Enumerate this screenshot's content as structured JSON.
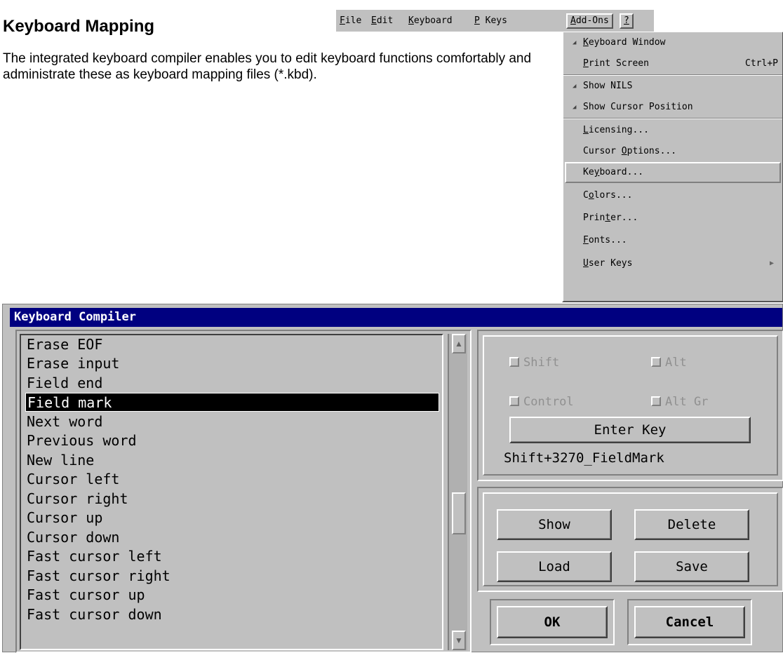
{
  "doc": {
    "title": "Keyboard Mapping",
    "body": "The integrated keyboard compiler enables you to edit keyboard functions comfortably and administrate these as keyboard mapping files (*.kbd)."
  },
  "menubar": {
    "items": [
      {
        "pre": "",
        "u": "F",
        "post": "ile"
      },
      {
        "pre": "",
        "u": "E",
        "post": "dit"
      },
      {
        "pre": "",
        "u": "K",
        "post": "eyboard"
      },
      {
        "pre": "",
        "u": "P",
        "post": " Keys"
      },
      {
        "pre": "",
        "u": "A",
        "post": "dd-Ons"
      },
      {
        "pre": "",
        "u": "?",
        "post": ""
      }
    ]
  },
  "addons_menu": {
    "items": [
      {
        "pre": "",
        "u": "K",
        "post": "eyboard Window",
        "checked": true
      },
      {
        "pre": "",
        "u": "P",
        "post": "rint Screen",
        "shortcut": "Ctrl+P"
      },
      {
        "pre": "Show NILS",
        "u": "",
        "post": "",
        "checked": true
      },
      {
        "pre": "Show Cursor Position",
        "u": "",
        "post": "",
        "checked": true
      },
      {
        "pre": "",
        "u": "L",
        "post": "icensing..."
      },
      {
        "pre": "Cursor ",
        "u": "O",
        "post": "ptions..."
      },
      {
        "pre": "Ke",
        "u": "y",
        "post": "board..."
      },
      {
        "pre": "C",
        "u": "o",
        "post": "lors..."
      },
      {
        "pre": "Prin",
        "u": "t",
        "post": "er..."
      },
      {
        "pre": "",
        "u": "F",
        "post": "onts..."
      },
      {
        "pre": "",
        "u": "U",
        "post": "ser Keys",
        "submenu": true
      }
    ]
  },
  "dialog": {
    "title": "Keyboard Compiler",
    "functions": [
      "Erase EOF",
      "Erase input",
      "Field end",
      "Field mark",
      "Next word",
      "Previous word",
      "New line",
      "Cursor left",
      "Cursor right",
      "Cursor up",
      "Cursor down",
      "Fast cursor left",
      "Fast cursor right",
      "Fast cursor up",
      "Fast cursor down"
    ],
    "selected_function": "Field mark",
    "modifiers": {
      "shift": "Shift",
      "alt": "Alt",
      "control": "Control",
      "alt_gr": "Alt Gr"
    },
    "enter_key_label": "Enter Key",
    "current_key": "Shift+3270_FieldMark",
    "buttons": {
      "show": "Show",
      "delete": "Delete",
      "load": "Load",
      "save": "Save",
      "ok": "OK",
      "cancel": "Cancel"
    }
  }
}
